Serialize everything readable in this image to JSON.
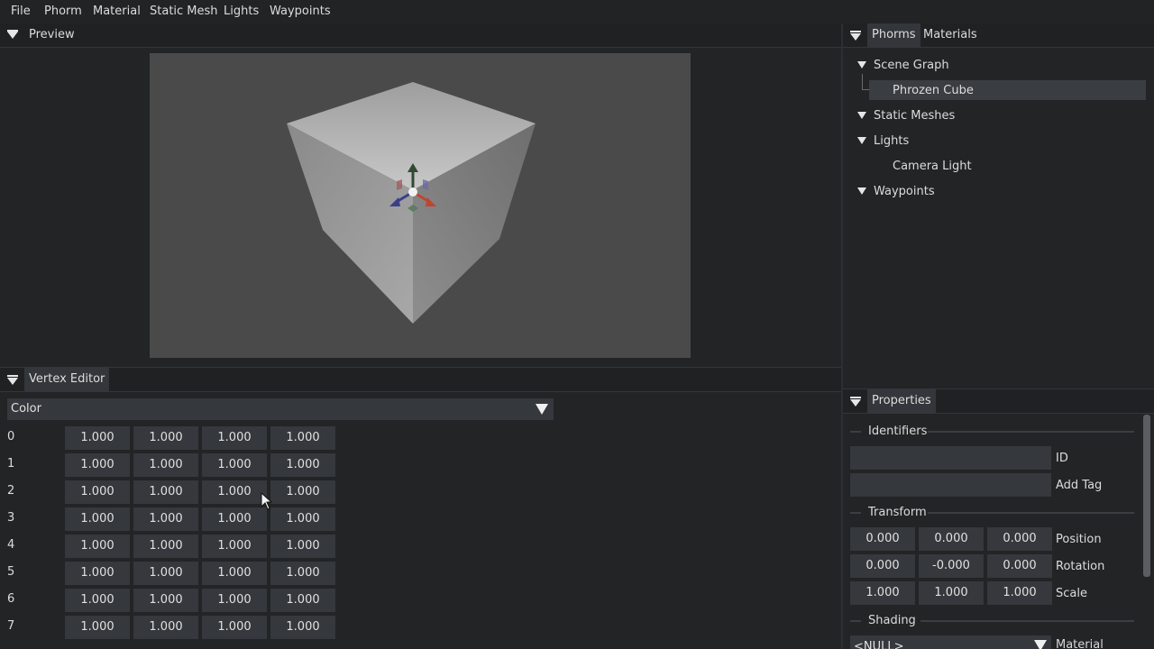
{
  "menu": [
    "File",
    "Phorm",
    "Material",
    "Static Mesh",
    "Lights",
    "Waypoints"
  ],
  "preview": {
    "title": "Preview"
  },
  "vertex_editor": {
    "title": "Vertex Editor",
    "attribute": "Color",
    "rows": [
      {
        "index": "0",
        "values": [
          "1.000",
          "1.000",
          "1.000",
          "1.000"
        ]
      },
      {
        "index": "1",
        "values": [
          "1.000",
          "1.000",
          "1.000",
          "1.000"
        ]
      },
      {
        "index": "2",
        "values": [
          "1.000",
          "1.000",
          "1.000",
          "1.000"
        ]
      },
      {
        "index": "3",
        "values": [
          "1.000",
          "1.000",
          "1.000",
          "1.000"
        ]
      },
      {
        "index": "4",
        "values": [
          "1.000",
          "1.000",
          "1.000",
          "1.000"
        ]
      },
      {
        "index": "5",
        "values": [
          "1.000",
          "1.000",
          "1.000",
          "1.000"
        ]
      },
      {
        "index": "6",
        "values": [
          "1.000",
          "1.000",
          "1.000",
          "1.000"
        ]
      },
      {
        "index": "7",
        "values": [
          "1.000",
          "1.000",
          "1.000",
          "1.000"
        ]
      }
    ]
  },
  "right_panel": {
    "tabs": [
      "Phorms",
      "Materials"
    ],
    "tree": {
      "scene_graph": "Scene Graph",
      "phrozen_cube": "Phrozen Cube",
      "static_meshes": "Static Meshes",
      "lights": "Lights",
      "camera_light": "Camera Light",
      "waypoints": "Waypoints"
    }
  },
  "properties": {
    "title": "Properties",
    "identifiers": "Identifiers",
    "id_label": "ID",
    "id_value": "",
    "add_tag_label": "Add Tag",
    "add_tag_value": "",
    "transform": "Transform",
    "position_label": "Position",
    "position": [
      "0.000",
      "0.000",
      "0.000"
    ],
    "rotation_label": "Rotation",
    "rotation": [
      "0.000",
      "-0.000",
      "0.000"
    ],
    "scale_label": "Scale",
    "scale": [
      "1.000",
      "1.000",
      "1.000"
    ],
    "shading": "Shading",
    "material_label": "Material",
    "material_value": "<NULL>"
  },
  "colors": {
    "background": "#222426",
    "field": "#35383c",
    "viewport": "#4a4a4a",
    "gizmo_y": "#3e5a45",
    "gizmo_x": "#c0452e",
    "gizmo_z": "#3a3f8a"
  }
}
